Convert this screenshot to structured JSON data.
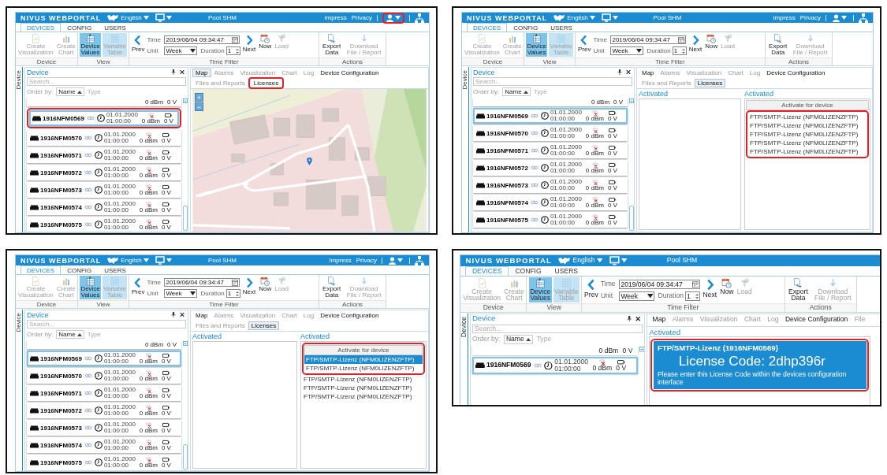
{
  "panels": [
    {
      "kind": "map",
      "header": {
        "logo": "NIVUS WEBPORTAL",
        "language": "English",
        "title": "Pool SHM",
        "links": [
          "Impress",
          "Privacy"
        ],
        "user_menu": {
          "highlighted": true
        }
      },
      "ribbon": {
        "tabs": [
          {
            "label": "DEVICES",
            "selected": true
          },
          {
            "label": "CONFIG",
            "selected": false
          },
          {
            "label": "USERS",
            "selected": false
          }
        ],
        "groups": [
          {
            "label": "Device",
            "items": [
              {
                "kind": "button",
                "label": "Create Visualization",
                "selected": false,
                "disabled": true
              },
              {
                "kind": "button",
                "label": "Create Chart",
                "selected": false,
                "disabled": true
              }
            ]
          },
          {
            "label": "View",
            "items": [
              {
                "kind": "button",
                "label": "Device Values",
                "selected": true,
                "disabled": false
              },
              {
                "kind": "button",
                "label": "Variable Table",
                "selected": true,
                "disabled": true
              }
            ]
          },
          {
            "label": "Time Filter",
            "items": [
              {
                "kind": "prev",
                "label": "Prev"
              },
              {
                "kind": "fields",
                "time_label": "Time",
                "time": "2019/06/04 09:34:47",
                "unit_label": "Unit",
                "unit": "Week",
                "duration_label": "Duration",
                "duration": "1"
              },
              {
                "kind": "next",
                "label": "Next"
              },
              {
                "kind": "button",
                "label": "Now",
                "selected": false,
                "disabled": false
              },
              {
                "kind": "button",
                "label": "Load",
                "selected": false,
                "disabled": true
              }
            ]
          },
          {
            "label": "Actions",
            "items": [
              {
                "kind": "button",
                "label": "Export Data",
                "selected": false,
                "disabled": false
              },
              {
                "kind": "button",
                "label": "Download File / Report",
                "selected": false,
                "disabled": true
              }
            ]
          }
        ]
      },
      "side_tab": "Device",
      "devices_panel": {
        "title": "Device",
        "placeholder": "Search...",
        "order_label": "Order by:",
        "sort": "Name",
        "sort_alt": "Type",
        "devices": [
          {
            "kind": "partial",
            "signal": "0 dBm",
            "voltage": "0 V"
          },
          {
            "kind": "device",
            "name": "1916NFM0569",
            "date": "01.01.2000 01:00:00",
            "signal": "0 dBm",
            "voltage": "0 V",
            "selected": true,
            "highlighted": true
          },
          {
            "kind": "device",
            "name": "1916NFM0570",
            "date": "01.01.2000 01:00:00",
            "signal": "0 dBm",
            "voltage": "0 V",
            "selected": false,
            "highlighted": false
          },
          {
            "kind": "device",
            "name": "1916NFM0571",
            "date": "01.01.2000 01:00:00",
            "signal": "0 dBm",
            "voltage": "0 V",
            "selected": false,
            "highlighted": false
          },
          {
            "kind": "device",
            "name": "1916NFM0572",
            "date": "01.01.2000 01:00:00",
            "signal": "0 dBm",
            "voltage": "0 V",
            "selected": false,
            "highlighted": false
          },
          {
            "kind": "device",
            "name": "1916NFM0573",
            "date": "01.01.2000 01:00:00",
            "signal": "0 dBm",
            "voltage": "0 V",
            "selected": false,
            "highlighted": false
          },
          {
            "kind": "device",
            "name": "1916NFM0574",
            "date": "01.01.2000 01:00:00",
            "signal": "0 dBm",
            "voltage": "0 V",
            "selected": false,
            "highlighted": false
          },
          {
            "kind": "device",
            "name": "1916NFM0575",
            "date": "01.01.2000 01:00:00",
            "signal": "0 dBm",
            "voltage": "0 V",
            "selected": false,
            "highlighted": false
          }
        ]
      },
      "content": {
        "tabs": [
          {
            "label": "Map",
            "selected": true,
            "disabled": false,
            "highlighted": false
          },
          {
            "label": "Alarms",
            "selected": false,
            "disabled": true,
            "highlighted": false
          },
          {
            "label": "Visualization",
            "selected": false,
            "disabled": true,
            "highlighted": false
          },
          {
            "label": "Chart",
            "selected": false,
            "disabled": true,
            "highlighted": false
          },
          {
            "label": "Log",
            "selected": false,
            "disabled": true,
            "highlighted": false
          },
          {
            "label": "Device Configuration",
            "selected": false,
            "disabled": false,
            "highlighted": false
          },
          {
            "label": "Files and Reports",
            "selected": false,
            "disabled": true,
            "highlighted": false
          },
          {
            "label": "Licenses",
            "selected": false,
            "disabled": false,
            "highlighted": true
          }
        ],
        "view": {
          "kind": "map",
          "zoom_in": "+",
          "zoom_out": "−"
        }
      }
    },
    {
      "kind": "licenses",
      "header": {
        "logo": "NIVUS WEBPORTAL",
        "language": "English",
        "title": "Pool SHM",
        "links": [
          "Impress",
          "Privacy"
        ],
        "user_menu": {
          "highlighted": false
        }
      },
      "ribbon": {
        "tabs": [
          {
            "label": "DEVICES",
            "selected": true
          },
          {
            "label": "CONFIG",
            "selected": false
          },
          {
            "label": "USERS",
            "selected": false
          }
        ],
        "groups": [
          {
            "label": "Device",
            "items": [
              {
                "kind": "button",
                "label": "Create Visualization",
                "selected": false,
                "disabled": true
              },
              {
                "kind": "button",
                "label": "Create Chart",
                "selected": false,
                "disabled": true
              }
            ]
          },
          {
            "label": "View",
            "items": [
              {
                "kind": "button",
                "label": "Device Values",
                "selected": true,
                "disabled": false
              },
              {
                "kind": "button",
                "label": "Variable Table",
                "selected": true,
                "disabled": true
              }
            ]
          },
          {
            "label": "Time Filter",
            "items": [
              {
                "kind": "prev",
                "label": "Prev"
              },
              {
                "kind": "fields",
                "time_label": "Time",
                "time": "2019/06/04 09:34:47",
                "unit_label": "Unit",
                "unit": "Week",
                "duration_label": "Duration",
                "duration": "1"
              },
              {
                "kind": "next",
                "label": "Next"
              },
              {
                "kind": "button",
                "label": "Now",
                "selected": false,
                "disabled": false
              },
              {
                "kind": "button",
                "label": "Load",
                "selected": false,
                "disabled": true
              }
            ]
          },
          {
            "label": "Actions",
            "items": [
              {
                "kind": "button",
                "label": "Export Data",
                "selected": false,
                "disabled": false
              },
              {
                "kind": "button",
                "label": "Download File / Report",
                "selected": false,
                "disabled": true
              }
            ]
          }
        ]
      },
      "side_tab": "Device",
      "devices_panel": {
        "title": "Device",
        "placeholder": "Search...",
        "order_label": "Order by:",
        "sort": "Name",
        "sort_alt": "Type",
        "devices": [
          {
            "kind": "partial",
            "signal": "0 dBm",
            "voltage": "0 V"
          },
          {
            "kind": "device",
            "name": "1916NFM0569",
            "date": "01.01.2000 01:00:00",
            "signal": "0 dBm",
            "voltage": "0 V",
            "selected": true,
            "highlighted": false
          },
          {
            "kind": "device",
            "name": "1916NFM0570",
            "date": "01.01.2000 01:00:00",
            "signal": "0 dBm",
            "voltage": "0 V",
            "selected": false,
            "highlighted": false
          },
          {
            "kind": "device",
            "name": "1916NFM0571",
            "date": "01.01.2000 01:00:00",
            "signal": "0 dBm",
            "voltage": "0 V",
            "selected": false,
            "highlighted": false
          },
          {
            "kind": "device",
            "name": "1916NFM0572",
            "date": "01.01.2000 01:00:00",
            "signal": "0 dBm",
            "voltage": "0 V",
            "selected": false,
            "highlighted": false
          },
          {
            "kind": "device",
            "name": "1916NFM0573",
            "date": "01.01.2000 01:00:00",
            "signal": "0 dBm",
            "voltage": "0 V",
            "selected": false,
            "highlighted": false
          },
          {
            "kind": "device",
            "name": "1916NFM0574",
            "date": "01.01.2000 01:00:00",
            "signal": "0 dBm",
            "voltage": "0 V",
            "selected": false,
            "highlighted": false
          },
          {
            "kind": "device",
            "name": "1916NFM0575",
            "date": "01.01.2000 01:00:00",
            "signal": "0 dBm",
            "voltage": "0 V",
            "selected": false,
            "highlighted": false
          }
        ]
      },
      "content": {
        "tabs": [
          {
            "label": "Map",
            "selected": false,
            "disabled": false,
            "highlighted": false
          },
          {
            "label": "Alarms",
            "selected": false,
            "disabled": true,
            "highlighted": false
          },
          {
            "label": "Visualization",
            "selected": false,
            "disabled": true,
            "highlighted": false
          },
          {
            "label": "Chart",
            "selected": false,
            "disabled": true,
            "highlighted": false
          },
          {
            "label": "Log",
            "selected": false,
            "disabled": true,
            "highlighted": false
          },
          {
            "label": "Device Configuration",
            "selected": false,
            "disabled": false,
            "highlighted": false
          },
          {
            "label": "Files and Reports",
            "selected": false,
            "disabled": true,
            "highlighted": false
          },
          {
            "label": "Licenses",
            "selected": true,
            "disabled": false,
            "highlighted": false
          }
        ],
        "view": {
          "kind": "licenses",
          "activated_label": "Activated",
          "device_label": "Activated",
          "button": {
            "label": "Activate for device",
            "highlighted": false
          },
          "items": [
            {
              "label": "FTP/SMTP-Lizenz (NFM0LIZENZFTP)",
              "selected": false,
              "highlighted": true
            },
            {
              "label": "FTP/SMTP-Lizenz (NFM0LIZENZFTP)",
              "selected": false,
              "highlighted": true
            },
            {
              "label": "FTP/SMTP-Lizenz (NFM0LIZENZFTP)",
              "selected": false,
              "highlighted": true
            },
            {
              "label": "FTP/SMTP-Lizenz (NFM0LIZENZFTP)",
              "selected": false,
              "highlighted": true
            },
            {
              "label": "FTP/SMTP-Lizenz (NFM0LIZENZFTP)",
              "selected": false,
              "highlighted": true
            }
          ]
        }
      }
    },
    {
      "kind": "licenses",
      "header": {
        "logo": "NIVUS WEBPORTAL",
        "language": "English",
        "title": "Pool SHM",
        "links": [
          "Impress",
          "Privacy"
        ],
        "user_menu": {
          "highlighted": false
        }
      },
      "ribbon": {
        "tabs": [
          {
            "label": "DEVICES",
            "selected": true
          },
          {
            "label": "CONFIG",
            "selected": false
          },
          {
            "label": "USERS",
            "selected": false
          }
        ],
        "groups": [
          {
            "label": "Device",
            "items": [
              {
                "kind": "button",
                "label": "Create Visualization",
                "selected": false,
                "disabled": true
              },
              {
                "kind": "button",
                "label": "Create Chart",
                "selected": false,
                "disabled": true
              }
            ]
          },
          {
            "label": "View",
            "items": [
              {
                "kind": "button",
                "label": "Device Values",
                "selected": true,
                "disabled": false
              },
              {
                "kind": "button",
                "label": "Variable Table",
                "selected": true,
                "disabled": true
              }
            ]
          },
          {
            "label": "Time Filter",
            "items": [
              {
                "kind": "prev",
                "label": "Prev"
              },
              {
                "kind": "fields",
                "time_label": "Time",
                "time": "2019/06/04 09:34:47",
                "unit_label": "Unit",
                "unit": "Week",
                "duration_label": "Duration",
                "duration": "1"
              },
              {
                "kind": "next",
                "label": "Next"
              },
              {
                "kind": "button",
                "label": "Now",
                "selected": false,
                "disabled": false
              },
              {
                "kind": "button",
                "label": "Load",
                "selected": false,
                "disabled": true
              }
            ]
          },
          {
            "label": "Actions",
            "items": [
              {
                "kind": "button",
                "label": "Export Data",
                "selected": false,
                "disabled": false
              },
              {
                "kind": "button",
                "label": "Download File / Report",
                "selected": false,
                "disabled": true
              }
            ]
          }
        ]
      },
      "side_tab": "Device",
      "devices_panel": {
        "title": "Device",
        "placeholder": "Search...",
        "order_label": "Order by:",
        "sort": "Name",
        "sort_alt": "Type",
        "devices": [
          {
            "kind": "partial",
            "signal": "0 dBm",
            "voltage": "0 V"
          },
          {
            "kind": "device",
            "name": "1916NFM0569",
            "date": "01.01.2000 01:00:00",
            "signal": "0 dBm",
            "voltage": "0 V",
            "selected": true,
            "highlighted": false
          },
          {
            "kind": "device",
            "name": "1916NFM0570",
            "date": "01.01.2000 01:00:00",
            "signal": "0 dBm",
            "voltage": "0 V",
            "selected": false,
            "highlighted": false
          },
          {
            "kind": "device",
            "name": "1916NFM0571",
            "date": "01.01.2000 01:00:00",
            "signal": "0 dBm",
            "voltage": "0 V",
            "selected": false,
            "highlighted": false
          },
          {
            "kind": "device",
            "name": "1916NFM0572",
            "date": "01.01.2000 01:00:00",
            "signal": "0 dBm",
            "voltage": "0 V",
            "selected": false,
            "highlighted": false
          },
          {
            "kind": "device",
            "name": "1916NFM0573",
            "date": "01.01.2000 01:00:00",
            "signal": "0 dBm",
            "voltage": "0 V",
            "selected": false,
            "highlighted": false
          },
          {
            "kind": "device",
            "name": "1916NFM0574",
            "date": "01.01.2000 01:00:00",
            "signal": "0 dBm",
            "voltage": "0 V",
            "selected": false,
            "highlighted": false
          },
          {
            "kind": "device",
            "name": "1916NFM0575",
            "date": "01.01.2000 01:00:00",
            "signal": "0 dBm",
            "voltage": "0 V",
            "selected": false,
            "highlighted": false
          }
        ]
      },
      "content": {
        "tabs": [
          {
            "label": "Map",
            "selected": false,
            "disabled": false,
            "highlighted": false
          },
          {
            "label": "Alarms",
            "selected": false,
            "disabled": true,
            "highlighted": false
          },
          {
            "label": "Visualization",
            "selected": false,
            "disabled": true,
            "highlighted": false
          },
          {
            "label": "Chart",
            "selected": false,
            "disabled": true,
            "highlighted": false
          },
          {
            "label": "Log",
            "selected": false,
            "disabled": true,
            "highlighted": false
          },
          {
            "label": "Device Configuration",
            "selected": false,
            "disabled": false,
            "highlighted": false
          },
          {
            "label": "Files and Reports",
            "selected": false,
            "disabled": true,
            "highlighted": false
          },
          {
            "label": "Licenses",
            "selected": true,
            "disabled": false,
            "highlighted": false
          }
        ],
        "view": {
          "kind": "licenses",
          "activated_label": "Activated",
          "device_label": "Activated",
          "button": {
            "label": "Activate for device",
            "highlighted": true
          },
          "items": [
            {
              "label": "FTP/SMTP-Lizenz (NFM0LIZENZFTP)",
              "selected": true,
              "highlighted": true
            },
            {
              "label": "FTP/SMTP-Lizenz (NFM0LIZENZFTP)",
              "selected": false,
              "highlighted": true
            },
            {
              "label": "FTP/SMTP-Lizenz (NFM0LIZENZFTP)",
              "selected": false,
              "highlighted": false
            },
            {
              "label": "FTP/SMTP-Lizenz (NFM0LIZENZFTP)",
              "selected": false,
              "highlighted": false
            },
            {
              "label": "FTP/SMTP-Lizenz (NFM0LIZENZFTP)",
              "selected": false,
              "highlighted": false
            }
          ]
        }
      }
    },
    {
      "kind": "license_code",
      "header": {
        "logo": "NIVUS WEBPORTAL",
        "language": "English",
        "title": "Pool SHM"
      },
      "ribbon": {
        "tabs": [
          {
            "label": "DEVICES",
            "selected": true
          },
          {
            "label": "CONFIG",
            "selected": false
          },
          {
            "label": "USERS",
            "selected": false
          }
        ],
        "groups": [
          {
            "label": "Device",
            "items": [
              {
                "kind": "button",
                "label": "Create Visualization",
                "selected": false,
                "disabled": true
              },
              {
                "kind": "button",
                "label": "Create Chart",
                "selected": false,
                "disabled": true
              }
            ]
          },
          {
            "label": "View",
            "items": [
              {
                "kind": "button",
                "label": "Device Values",
                "selected": true,
                "disabled": false
              },
              {
                "kind": "button",
                "label": "Variable Table",
                "selected": true,
                "disabled": true
              }
            ]
          },
          {
            "label": "Time Filter",
            "items": [
              {
                "kind": "prev",
                "label": "Prev"
              },
              {
                "kind": "fields",
                "time_label": "Time",
                "time": "2019/06/04 09:34:47",
                "unit_label": "Unit",
                "unit": "Week",
                "duration_label": "Duration",
                "duration": "1"
              },
              {
                "kind": "next",
                "label": "Next"
              },
              {
                "kind": "button",
                "label": "Now",
                "selected": false,
                "disabled": false
              },
              {
                "kind": "button",
                "label": "Load",
                "selected": false,
                "disabled": true
              }
            ]
          },
          {
            "label": "Actions",
            "items": [
              {
                "kind": "button",
                "label": "Export Data",
                "selected": false,
                "disabled": false
              },
              {
                "kind": "button",
                "label": "Download File / Report",
                "selected": false,
                "disabled": true
              }
            ]
          }
        ]
      },
      "side_tab": "Device",
      "devices_panel": {
        "title": "Device",
        "placeholder": "Search...",
        "order_label": "Order by:",
        "sort": "Name",
        "sort_alt": "Type",
        "devices": [
          {
            "kind": "partial",
            "signal": "0 dBm",
            "voltage": "0 V"
          },
          {
            "kind": "device",
            "name": "1916NFM0569",
            "date": "01.01.2000 01:00:00",
            "signal": "0 dBm",
            "voltage": "0 V",
            "selected": true,
            "highlighted": false
          }
        ]
      },
      "content": {
        "tabs": [
          {
            "label": "Map",
            "selected": false,
            "disabled": false,
            "highlighted": false
          },
          {
            "label": "Alarms",
            "selected": false,
            "disabled": true,
            "highlighted": false
          },
          {
            "label": "Visualization",
            "selected": false,
            "disabled": true,
            "highlighted": false
          },
          {
            "label": "Chart",
            "selected": false,
            "disabled": true,
            "highlighted": false
          },
          {
            "label": "Log",
            "selected": false,
            "disabled": true,
            "highlighted": false
          },
          {
            "label": "Device Configuration",
            "selected": false,
            "disabled": false,
            "highlighted": false
          },
          {
            "label": "File",
            "selected": false,
            "disabled": true,
            "highlighted": false
          }
        ],
        "view": {
          "kind": "license_code",
          "activated_label": "Activated",
          "card": {
            "title": "FTP/SMTP-Lizenz (1916NFM0569)",
            "code": "License Code: 2dhp396r",
            "note": "Please enter this License Code within the devices configuration interface",
            "highlighted": true
          }
        }
      }
    }
  ]
}
